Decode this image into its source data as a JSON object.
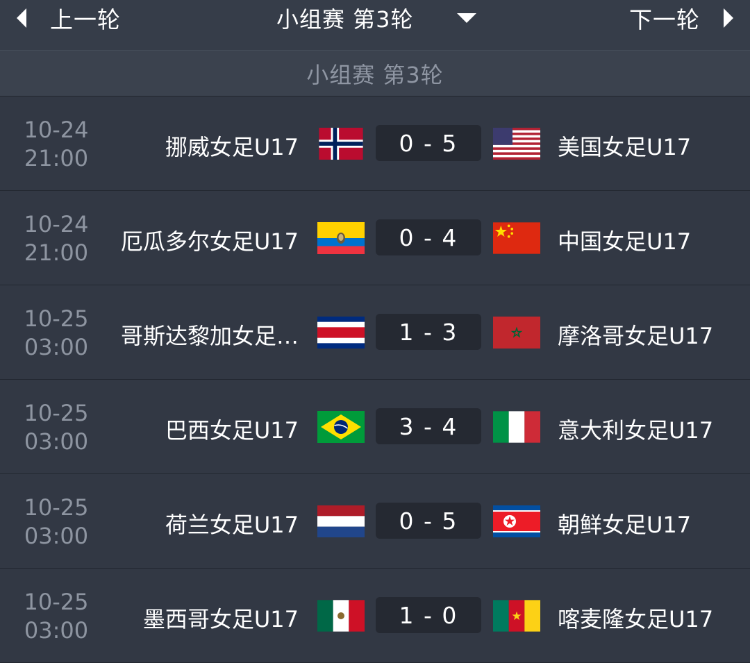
{
  "nav": {
    "prev_label": "上一轮",
    "round_label": "小组赛 第3轮",
    "next_label": "下一轮"
  },
  "section": {
    "title": "小组赛 第3轮"
  },
  "matches": [
    {
      "date": "10-24",
      "time": "21:00",
      "home": "挪威女足U17",
      "score": "0 - 5",
      "away": "美国女足U17",
      "home_flag": "norway-flag",
      "away_flag": "usa-flag"
    },
    {
      "date": "10-24",
      "time": "21:00",
      "home": "厄瓜多尔女足U17",
      "score": "0 - 4",
      "away": "中国女足U17",
      "home_flag": "ecuador-flag",
      "away_flag": "china-flag"
    },
    {
      "date": "10-25",
      "time": "03:00",
      "home": "哥斯达黎加女足…",
      "score": "1 - 3",
      "away": "摩洛哥女足U17",
      "home_flag": "costa-rica-flag",
      "away_flag": "morocco-flag"
    },
    {
      "date": "10-25",
      "time": "03:00",
      "home": "巴西女足U17",
      "score": "3 - 4",
      "away": "意大利女足U17",
      "home_flag": "brazil-flag",
      "away_flag": "italy-flag"
    },
    {
      "date": "10-25",
      "time": "03:00",
      "home": "荷兰女足U17",
      "score": "0 - 5",
      "away": "朝鲜女足U17",
      "home_flag": "netherlands-flag",
      "away_flag": "north-korea-flag"
    },
    {
      "date": "10-25",
      "time": "03:00",
      "home": "墨西哥女足U17",
      "score": "1 - 0",
      "away": "喀麦隆女足U17",
      "home_flag": "mexico-flag",
      "away_flag": "cameroon-flag"
    }
  ],
  "colors": {
    "background": "#323844",
    "score_box": "#252932",
    "muted_text": "#8e95a1"
  }
}
